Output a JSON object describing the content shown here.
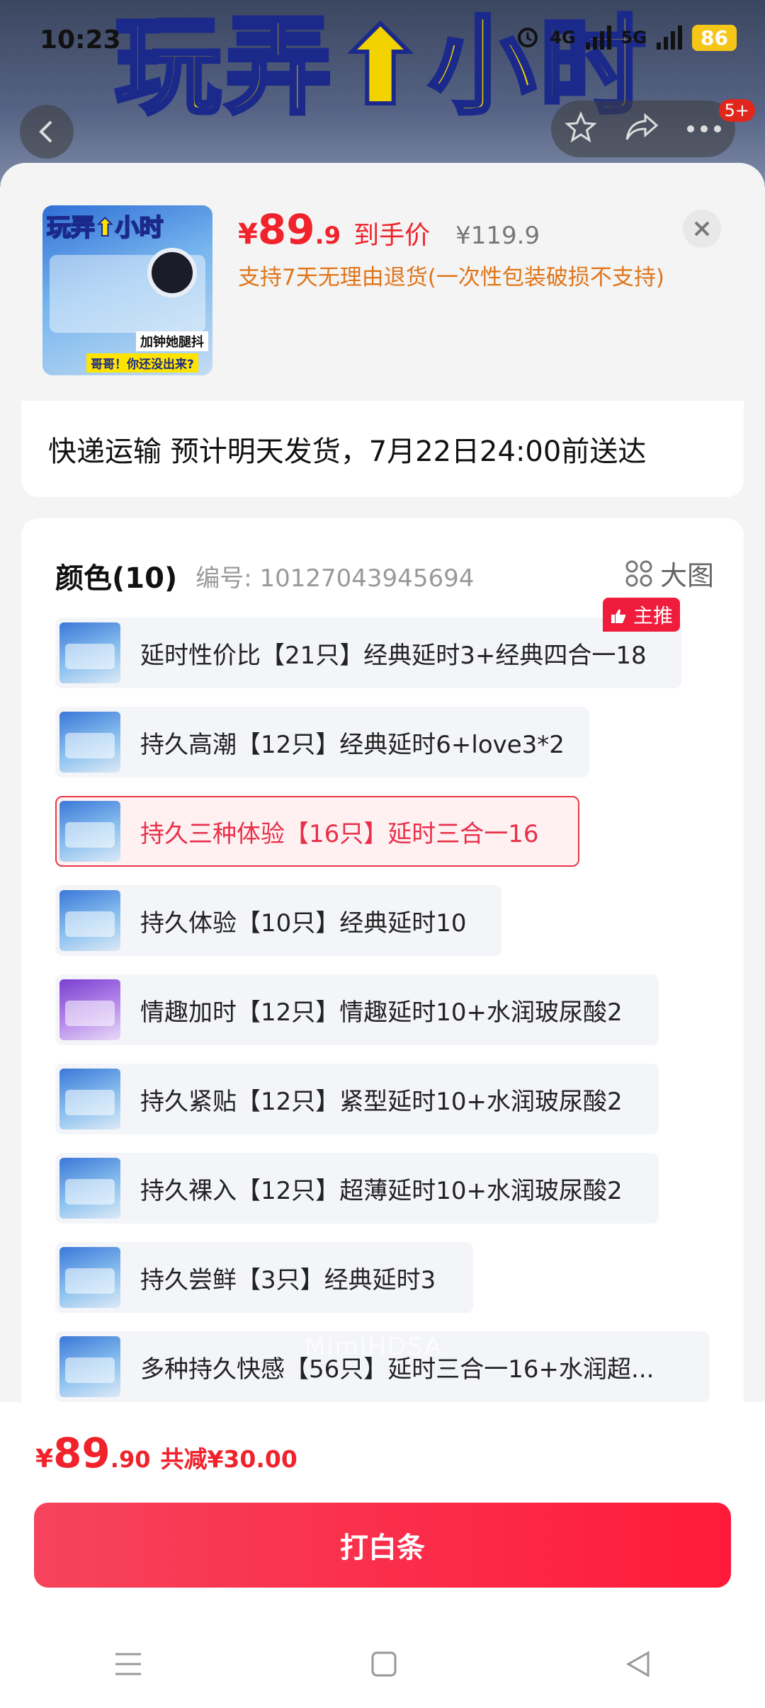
{
  "status_bar": {
    "time": "10:23",
    "signal_1": "4G",
    "signal_2": "5G",
    "battery": "86"
  },
  "banner": {
    "text": "玩弄⬆小时"
  },
  "header": {
    "badge": "5+"
  },
  "product": {
    "thumb_title": "玩弄⬆小时",
    "thumb_tag1": "加钟她腿抖",
    "thumb_tag2": "哥哥！你还没出来?",
    "price_currency": "¥",
    "price_int": "89",
    "price_dec": ".9",
    "price_tag": "到手价",
    "original_price": "¥119.9",
    "return_policy": "支持7天无理由退货(一次性包装破损不支持)"
  },
  "shipping": {
    "text": "快递运输 预计明天发货，7月22日24:00前送达"
  },
  "spec": {
    "title": "颜色(10)",
    "code": "编号: 10127043945694",
    "big_view": "大图",
    "recommended": "主推",
    "watermark": "MimiHDSA",
    "options": [
      {
        "label": "延时性价比【21只】经典延时3+经典四合一18",
        "selected": false
      },
      {
        "label": "持久高潮【12只】经典延时6+love3*2",
        "selected": false
      },
      {
        "label": "持久三种体验【16只】延时三合一16",
        "selected": true
      },
      {
        "label": "持久体验【10只】经典延时10",
        "selected": false
      },
      {
        "label": "情趣加时【12只】情趣延时10+水润玻尿酸2",
        "selected": false
      },
      {
        "label": "持久紧贴【12只】紧型延时10+水润玻尿酸2",
        "selected": false
      },
      {
        "label": "持久裸入【12只】超薄延时10+水润玻尿酸2",
        "selected": false
      },
      {
        "label": "持久尝鲜【3只】经典延时3",
        "selected": false
      },
      {
        "label": "多种持久快感【56只】延时三合一16+水润超...",
        "selected": false
      }
    ]
  },
  "footer": {
    "currency": "¥",
    "price_int": "89",
    "price_dec": ".90",
    "savings": "共减¥30.00",
    "buy_button": "打白条"
  },
  "colors": {
    "accent": "#f0232c",
    "selected_border": "#e8384a",
    "policy": "#e0751a"
  }
}
